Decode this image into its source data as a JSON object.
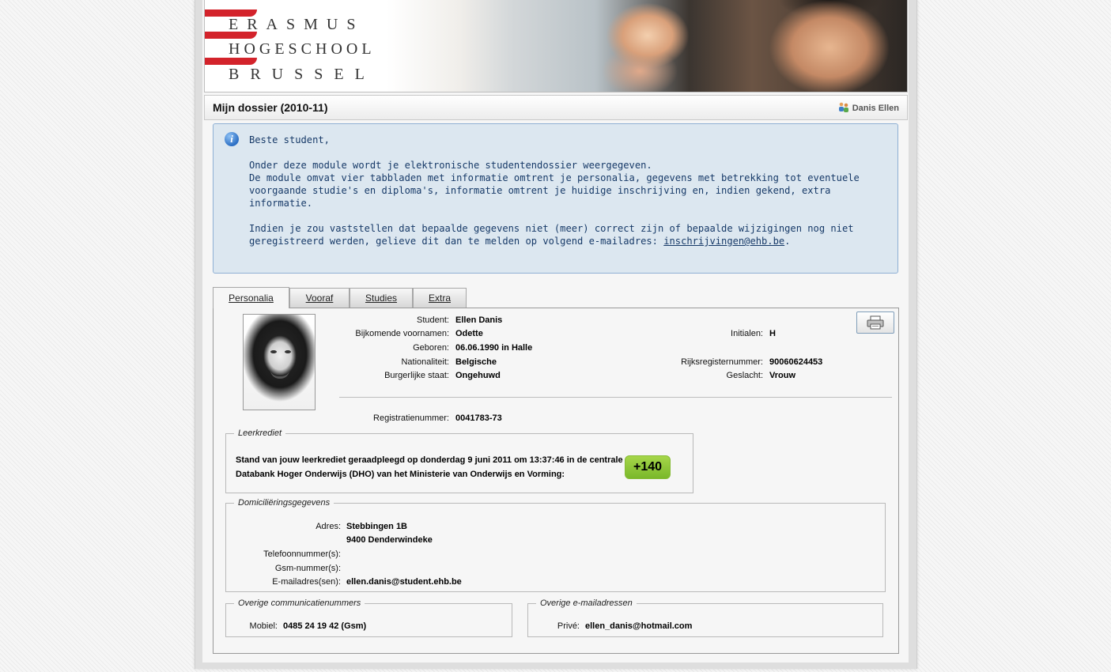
{
  "logo": {
    "line1": "ERASMUS",
    "line2": "HOGESCHOOL",
    "line3": "BRUSSEL"
  },
  "header": {
    "title": "Mijn dossier (2010-11)",
    "user": "Danis Ellen"
  },
  "info": {
    "greeting": "Beste student,",
    "p1": "Onder deze module wordt je elektronische studentendossier weergegeven.",
    "p2": "De module omvat vier tabbladen met informatie omtrent je personalia, gegevens met betrekking tot eventuele voorgaande studie's en diploma's, informatie omtrent je huidige inschrijving en, indien gekend, extra informatie.",
    "p3_before": "Indien je zou vaststellen dat bepaalde gegevens niet (meer) correct zijn of bepaalde wijzigingen nog niet geregistreerd werden, gelieve dit dan te melden op volgend e-mailadres: ",
    "email_link": "inschrijvingen@ehb.be",
    "p3_after": "."
  },
  "tabs": [
    {
      "label": "Personalia",
      "active": true
    },
    {
      "label": "Vooraf",
      "active": false
    },
    {
      "label": "Studies",
      "active": false
    },
    {
      "label": "Extra",
      "active": false
    }
  ],
  "personalia": {
    "student_label": "Student:",
    "student": "Ellen Danis",
    "voornamen_label": "Bijkomende voornamen:",
    "voornamen": "Odette",
    "initialen_label": "Initialen:",
    "initialen": "H",
    "geboren_label": "Geboren:",
    "geboren": "06.06.1990 in Halle",
    "nationaliteit_label": "Nationaliteit:",
    "nationaliteit": "Belgische",
    "rijksregister_label": "Rijksregisternummer:",
    "rijksregister": "90060624453",
    "burgerlijke_label": "Burgerlijke staat:",
    "burgerlijke": "Ongehuwd",
    "geslacht_label": "Geslacht:",
    "geslacht": "Vrouw",
    "registratie_label": "Registratienummer:",
    "registratie": "0041783-73"
  },
  "leerkrediet": {
    "legend": "Leerkrediet",
    "text": "Stand van jouw leerkrediet geraadpleegd op donderdag 9 juni 2011 om 13:37:46 in de centrale Databank Hoger Onderwijs (DHO) van het Ministerie van Onderwijs en Vorming:",
    "value": "+140"
  },
  "domicilie": {
    "legend": "Domiciliëringsgegevens",
    "adres_label": "Adres:",
    "adres1": "Stebbingen 1B",
    "adres2": "9400 Denderwindeke",
    "telefoon_label": "Telefoonnummer(s):",
    "gsm_label": "Gsm-nummer(s):",
    "email_label": "E-mailadres(sen):",
    "email": "ellen.danis@student.ehb.be"
  },
  "communicatie": {
    "legend": "Overige communicatienummers",
    "mobiel_label": "Mobiel:",
    "mobiel": "0485 24 19 42 (Gsm)"
  },
  "emailadressen": {
    "legend": "Overige e-mailadressen",
    "prive_label": "Privé:",
    "prive": "ellen_danis@hotmail.com"
  },
  "colors": {
    "info_bg": "#dce7f0",
    "info_text": "#173a68",
    "badge": "#8cc63f",
    "logo_red": "#d3232b"
  }
}
